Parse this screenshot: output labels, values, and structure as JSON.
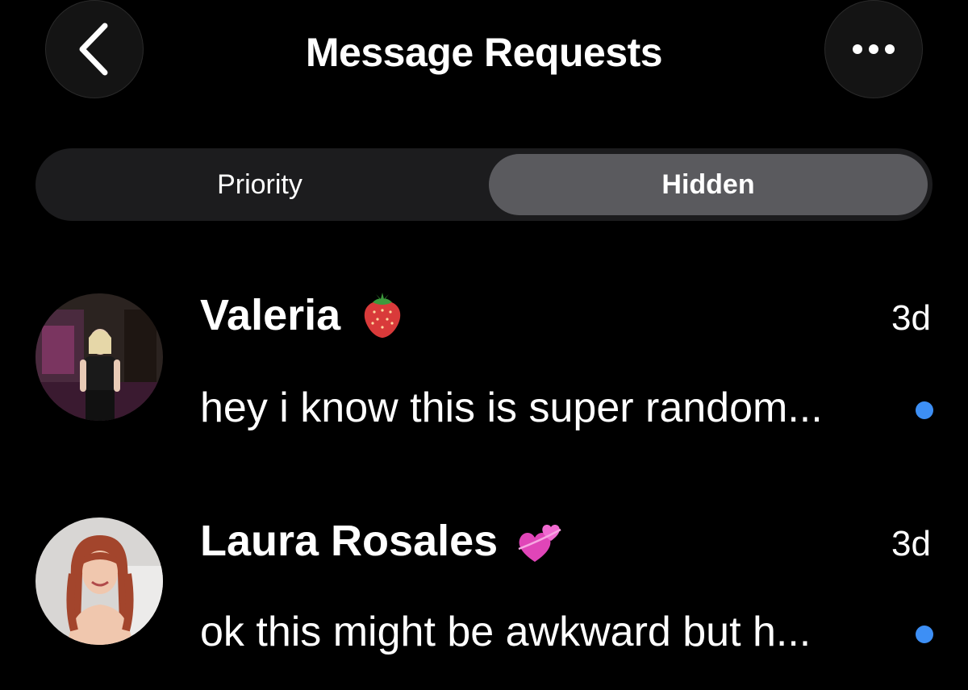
{
  "header": {
    "title": "Message Requests",
    "back_icon": "chevron-left-icon",
    "more_icon": "ellipsis-icon"
  },
  "tabs": [
    {
      "label": "Priority",
      "selected": false
    },
    {
      "label": "Hidden",
      "selected": true
    }
  ],
  "conversations": [
    {
      "name": "Valeria",
      "emoji": "strawberry-emoji",
      "time": "3d",
      "preview": "hey i know this is super random...",
      "unread": true
    },
    {
      "name": "Laura Rosales",
      "emoji": "two-hearts-emoji",
      "time": "3d",
      "preview": "ok this might be awkward but h...",
      "unread": true
    }
  ],
  "colors": {
    "background": "#000000",
    "segment_bg": "#1c1c1e",
    "segment_selected": "#5a5a5e",
    "unread_dot": "#3d8ff5"
  }
}
